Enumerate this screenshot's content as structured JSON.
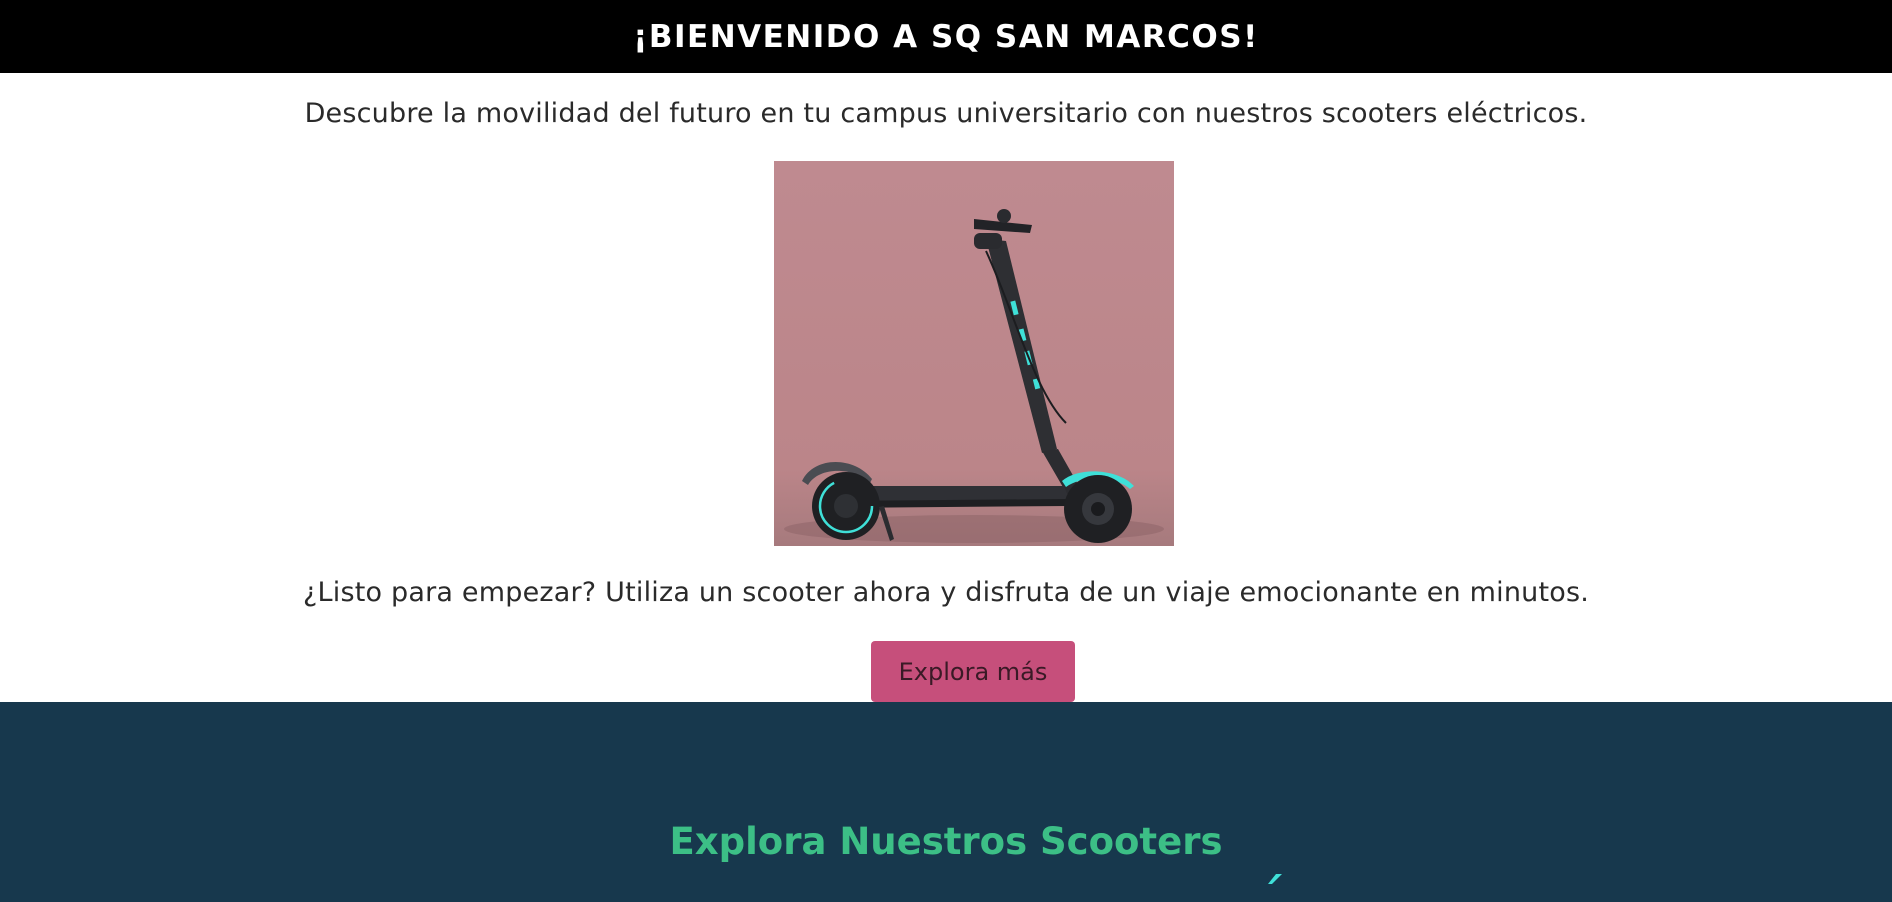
{
  "header": {
    "title": "¡BIENVENIDO A SQ SAN MARCOS!"
  },
  "hero": {
    "intro": "Descubre la movilidad del futuro en tu campus universitario con nuestros scooters eléctricos.",
    "image_alt": "scooter eléctrico",
    "cta_text": "¿Listo para empezar? Utiliza un scooter ahora y disfruta de un viaje emocionante en minutos.",
    "button_label": "Explora más"
  },
  "scooters_section": {
    "title": "Explora Nuestros Scooters"
  },
  "colors": {
    "header_bg": "#000000",
    "button_bg": "#c64f7b",
    "section_bg": "#17384d",
    "section_title": "#3cbf86",
    "accent_cyan": "#3fe0d8"
  }
}
